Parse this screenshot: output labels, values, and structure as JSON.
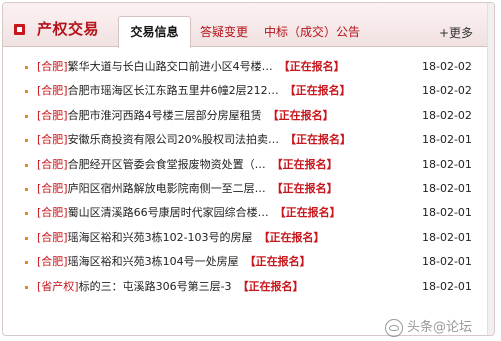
{
  "header": {
    "title": "产权交易",
    "tabs": [
      {
        "label": "交易信息",
        "active": true
      },
      {
        "label": "答疑变更",
        "active": false
      },
      {
        "label": "中标（成交）公告",
        "active": false
      }
    ],
    "more": "+更多"
  },
  "items": [
    {
      "tag": "[合肥]",
      "text": "繁华大道与长白山路交口前进小区4号楼…",
      "status": "【正在报名】",
      "date": "18-02-02"
    },
    {
      "tag": "[合肥]",
      "text": "合肥市瑶海区长江东路五里井6幢2层212…",
      "status": "【正在报名】",
      "date": "18-02-02"
    },
    {
      "tag": "[合肥]",
      "text": "合肥市淮河西路4号楼三层部分房屋租赁",
      "status": "【正在报名】",
      "date": "18-02-02"
    },
    {
      "tag": "[合肥]",
      "text": "安徽乐商投资有限公司20%股权司法拍卖…",
      "status": "【正在报名】",
      "date": "18-02-01"
    },
    {
      "tag": "[合肥]",
      "text": "合肥经开区管委会食堂报废物资处置（…",
      "status": "【正在报名】",
      "date": "18-02-01"
    },
    {
      "tag": "[合肥]",
      "text": "庐阳区宿州路解放电影院南侧一至二层…",
      "status": "【正在报名】",
      "date": "18-02-01"
    },
    {
      "tag": "[合肥]",
      "text": "蜀山区清溪路66号康居时代家园综合楼…",
      "status": "【正在报名】",
      "date": "18-02-01"
    },
    {
      "tag": "[合肥]",
      "text": "瑶海区裕和兴苑3栋102-103号的房屋",
      "status": "【正在报名】",
      "date": "18-02-01"
    },
    {
      "tag": "[合肥]",
      "text": "瑶海区裕和兴苑3栋104号一处房屋",
      "status": "【正在报名】",
      "date": "18-02-01"
    },
    {
      "tag": "[省产权]",
      "text": "标的三：屯溪路306号第三层-3",
      "status": "【正在报名】",
      "date": "18-02-01"
    }
  ],
  "watermark": "头条@论坛"
}
